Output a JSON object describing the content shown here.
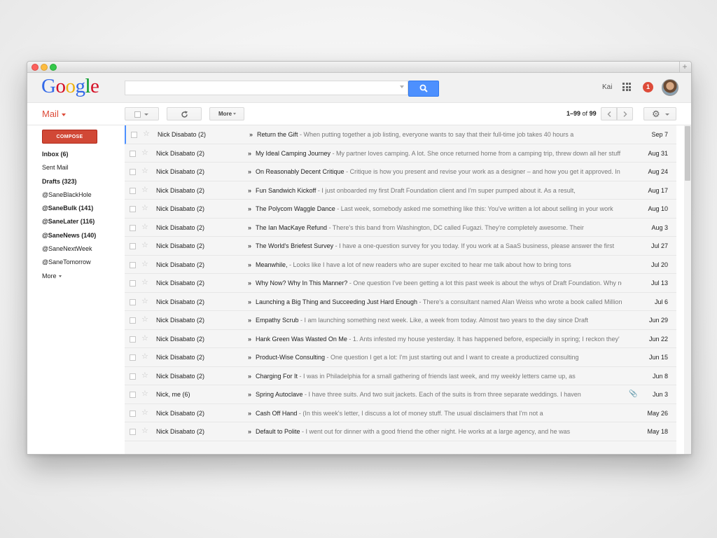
{
  "logo": {
    "letters": [
      "G",
      "o",
      "o",
      "g",
      "l",
      "e"
    ],
    "colors": [
      "#3369e8",
      "#d50f25",
      "#eeb211",
      "#3369e8",
      "#009925",
      "#d50f25"
    ]
  },
  "search": {
    "placeholder": ""
  },
  "user": {
    "name": "Kai",
    "notifications": "1"
  },
  "toolbar": {
    "mail_label": "Mail",
    "more_label": "More",
    "range": "1–99",
    "of_word": "of",
    "total": "99"
  },
  "sidebar": {
    "compose_label": "COMPOSE",
    "items": [
      {
        "label": "Inbox (6)",
        "bold": true
      },
      {
        "label": "Sent Mail",
        "bold": false
      },
      {
        "label": "Drafts (323)",
        "bold": true
      },
      {
        "label": "@SaneBlackHole",
        "bold": false
      },
      {
        "label": "@SaneBulk (141)",
        "bold": true
      },
      {
        "label": "@SaneLater (116)",
        "bold": true
      },
      {
        "label": "@SaneNews (140)",
        "bold": true
      },
      {
        "label": "@SaneNextWeek",
        "bold": false
      },
      {
        "label": "@SaneTomorrow",
        "bold": false
      },
      {
        "label": "More",
        "bold": false
      }
    ]
  },
  "emails": [
    {
      "sender": "Nick Disabato (2)",
      "subject": "Return the Gift",
      "snippet": " - When putting together a job listing, everyone wants to say that their full-time job takes 40 hours a",
      "date": "Sep 7",
      "attachment": false
    },
    {
      "sender": "Nick Disabato (2)",
      "subject": "My Ideal Camping Journey",
      "snippet": " - My partner loves camping. A lot. She once returned home from a camping trip, threw down all her stuff",
      "date": "Aug 31",
      "attachment": false
    },
    {
      "sender": "Nick Disabato (2)",
      "subject": "On Reasonably Decent Critique",
      "snippet": " - Critique is how you present and revise your work as a designer – and how you get it approved. In",
      "date": "Aug 24",
      "attachment": false
    },
    {
      "sender": "Nick Disabato (2)",
      "subject": "Fun Sandwich Kickoff",
      "snippet": " - I just onboarded my first Draft Foundation client and I'm super pumped about it. As a result,",
      "date": "Aug 17",
      "attachment": false
    },
    {
      "sender": "Nick Disabato (2)",
      "subject": "The Polycom Waggle Dance",
      "snippet": " - Last week, somebody asked me something like this: You've written a lot about selling in your work",
      "date": "Aug 10",
      "attachment": false
    },
    {
      "sender": "Nick Disabato (2)",
      "subject": "The Ian MacKaye Refund",
      "snippet": " - There's this band from Washington, DC called Fugazi. They're completely awesome. Their",
      "date": "Aug 3",
      "attachment": false
    },
    {
      "sender": "Nick Disabato (2)",
      "subject": "The World's Briefest Survey",
      "snippet": " - I have a one-question survey for you today. If you work at a SaaS business, please answer the first",
      "date": "Jul 27",
      "attachment": false
    },
    {
      "sender": "Nick Disabato (2)",
      "subject": "Meanwhile,",
      "snippet": " - Looks like I have a lot of new readers who are super excited to hear me talk about how to bring tons",
      "date": "Jul 20",
      "attachment": false
    },
    {
      "sender": "Nick Disabato (2)",
      "subject": "Why Now? Why In This Manner?",
      "snippet": " - One question I've been getting a lot this past week is about the whys of Draft Foundation. Why no",
      "date": "Jul 13",
      "attachment": false
    },
    {
      "sender": "Nick Disabato (2)",
      "subject": "Launching a Big Thing and Succeeding Just Hard Enough",
      "snippet": " - There's a consultant named Alan Weiss who wrote a book called Million D",
      "date": "Jul 6",
      "attachment": false
    },
    {
      "sender": "Nick Disabato (2)",
      "subject": "Empathy Scrub",
      "snippet": " - I am launching something next week. Like, a week from today. Almost two years to the day since Draft",
      "date": "Jun 29",
      "attachment": false
    },
    {
      "sender": "Nick Disabato (2)",
      "subject": "Hank Green Was Wasted On Me",
      "snippet": " - 1. Ants infested my house yesterday. It has happened before, especially in spring; I reckon they'",
      "date": "Jun 22",
      "attachment": false
    },
    {
      "sender": "Nick Disabato (2)",
      "subject": "Product-Wise Consulting",
      "snippet": " - One question I get a lot: I'm just starting out and I want to create a productized consulting",
      "date": "Jun 15",
      "attachment": false
    },
    {
      "sender": "Nick Disabato (2)",
      "subject": "Charging For It",
      "snippet": " - I was in Philadelphia for a small gathering of friends last week, and my weekly letters came up, as",
      "date": "Jun 8",
      "attachment": false
    },
    {
      "sender": "Nick, me (6)",
      "subject": "Spring Autoclave",
      "snippet": " - I have three suits. And two suit jackets. Each of the suits is from three separate weddings. I haven",
      "date": "Jun 3",
      "attachment": true
    },
    {
      "sender": "Nick Disabato (2)",
      "subject": "Cash Off Hand",
      "snippet": " - (In this week's letter, I discuss a lot of money stuff. The usual disclaimers that I'm not a",
      "date": "May 26",
      "attachment": false
    },
    {
      "sender": "Nick Disabato (2)",
      "subject": "Default to Polite",
      "snippet": " - I went out for dinner with a good friend the other night. He works at a large agency, and he was",
      "date": "May 18",
      "attachment": false
    }
  ],
  "colors": {
    "accent_red": "#dd4b39",
    "compose": "#d14836",
    "search_blue": "#4d90fe"
  }
}
